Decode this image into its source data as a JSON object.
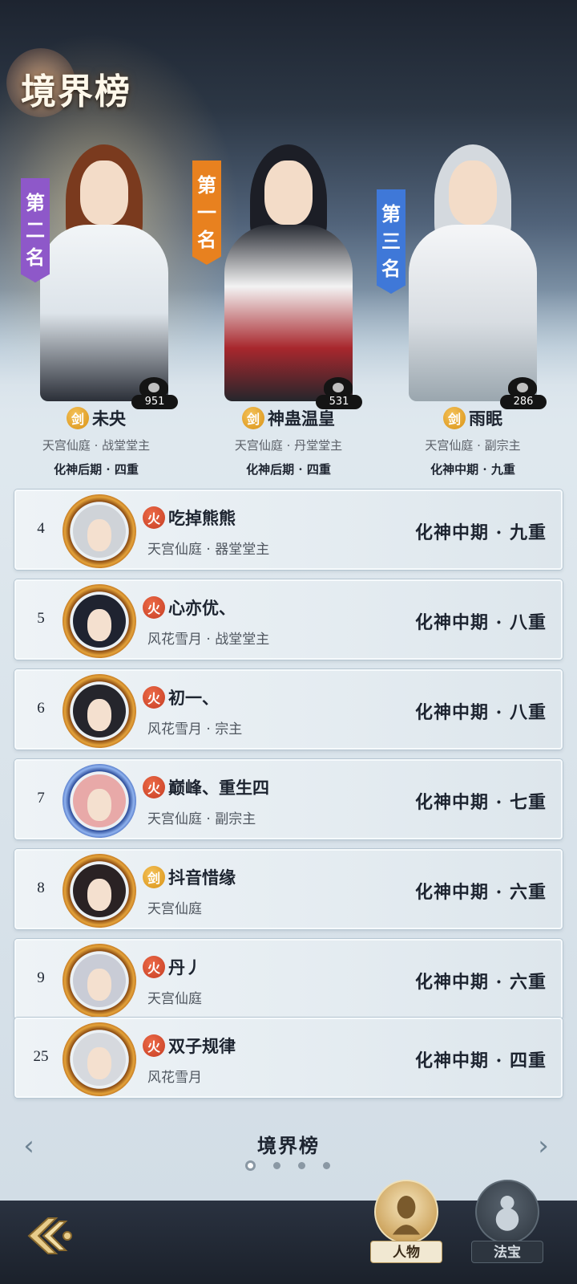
{
  "screen_title": "境界榜",
  "podium": [
    {
      "rank_label": [
        "第",
        "二",
        "名"
      ],
      "element": "剑",
      "name": "未央",
      "affiliation": "天宫仙庭 · 战堂堂主",
      "realm": "化神后期 · 四重",
      "likes": "951",
      "banner_color": "#8e58c9"
    },
    {
      "rank_label": [
        "第",
        "一",
        "名"
      ],
      "element": "剑",
      "name": "神蛊温皇",
      "affiliation": "天宫仙庭 · 丹堂堂主",
      "realm": "化神后期 · 四重",
      "likes": "531",
      "banner_color": "#e8811f"
    },
    {
      "rank_label": [
        "第",
        "三",
        "名"
      ],
      "element": "剑",
      "name": "雨眠",
      "affiliation": "天宫仙庭 · 副宗主",
      "realm": "化神中期 · 九重",
      "likes": "286",
      "banner_color": "#3f78d8"
    }
  ],
  "ranking": [
    {
      "rank": "4",
      "element": "火",
      "name": "吃掉熊熊",
      "affiliation": "天宫仙庭 · 器堂堂主",
      "realm": "化神中期 · 九重"
    },
    {
      "rank": "5",
      "element": "火",
      "name": "心亦优、",
      "affiliation": "风花雪月 · 战堂堂主",
      "realm": "化神中期 · 八重"
    },
    {
      "rank": "6",
      "element": "火",
      "name": "初一、",
      "affiliation": "风花雪月 · 宗主",
      "realm": "化神中期 · 八重"
    },
    {
      "rank": "7",
      "element": "火",
      "name": "巅峰、重生四",
      "affiliation": "天宫仙庭 · 副宗主",
      "realm": "化神中期 · 七重"
    },
    {
      "rank": "8",
      "element": "剑",
      "name": "抖音惜缘",
      "affiliation": "天宫仙庭",
      "realm": "化神中期 · 六重"
    },
    {
      "rank": "9",
      "element": "火",
      "name": "丹丿",
      "affiliation": "天宫仙庭",
      "realm": "化神中期 · 六重"
    },
    {
      "rank": "25",
      "element": "火",
      "name": "双子规律",
      "affiliation": "风花雪月",
      "realm": "化神中期 · 四重"
    }
  ],
  "pager": {
    "title": "境界榜",
    "page_count": 4,
    "active_page": 1,
    "prev_icon": "chevron-left-icon",
    "next_icon": "chevron-right-icon"
  },
  "bottom_tabs": [
    {
      "label": "人物",
      "icon": "person-icon",
      "active": true
    },
    {
      "label": "法宝",
      "icon": "gourd-icon",
      "active": false
    }
  ],
  "colors": {
    "sword_element": "#e0a027",
    "fire_element": "#d44f2e",
    "row_bg": "#e8eff4",
    "text_dark": "#1d2430"
  }
}
